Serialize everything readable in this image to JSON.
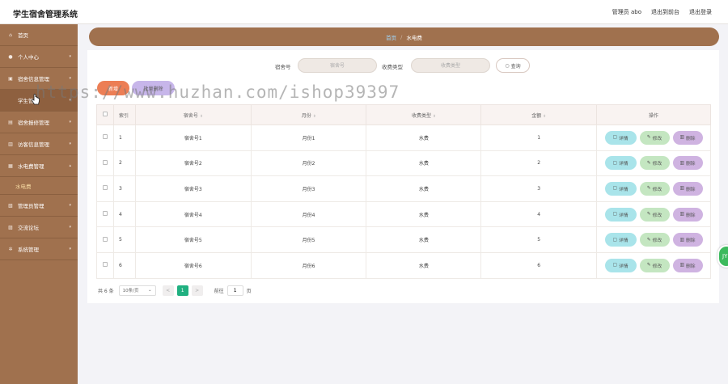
{
  "header": {
    "app_title": "学生宿舍管理系统",
    "user": "管理员 abo",
    "go_frontend": "退出到前台",
    "logout": "退出登录"
  },
  "sidebar": {
    "items": [
      {
        "label": "首页",
        "icon": "home-icon",
        "has_arrow": false
      },
      {
        "label": "个人中心",
        "icon": "user-icon",
        "has_arrow": true
      },
      {
        "label": "宿舍信息管理",
        "icon": "building-icon",
        "has_arrow": true
      },
      {
        "label": "学生管理",
        "icon": "student-icon",
        "has_arrow": true
      },
      {
        "label": "宿舍报修管理",
        "icon": "wrench-icon",
        "has_arrow": true
      },
      {
        "label": "访客信息管理",
        "icon": "visitor-icon",
        "has_arrow": true
      },
      {
        "label": "水电费管理",
        "icon": "bolt-icon",
        "has_arrow": true
      },
      {
        "label": "管理员管理",
        "icon": "admin-icon",
        "has_arrow": true
      },
      {
        "label": "交流论坛",
        "icon": "chat-icon",
        "has_arrow": true
      },
      {
        "label": "系统管理",
        "icon": "gear-icon",
        "has_arrow": true
      }
    ],
    "sub_item": "水电费"
  },
  "breadcrumb": {
    "home": "首页",
    "separator": "/",
    "current": "水电费"
  },
  "search": {
    "dorm_label": "宿舍号",
    "dorm_placeholder": "宿舍号",
    "type_label": "收费类型",
    "type_placeholder": "收费类型",
    "query_button": "查询"
  },
  "actions": {
    "add": "新增",
    "delete": "批量删除"
  },
  "watermark": "https://www.huzhan.com/ishop39397",
  "table": {
    "columns": [
      "索引",
      "宿舍号",
      "月份",
      "收费类型",
      "金额",
      "操作"
    ],
    "rows": [
      {
        "index": "1",
        "dorm": "宿舍号1",
        "month": "月份1",
        "type": "水费",
        "amount": "1"
      },
      {
        "index": "2",
        "dorm": "宿舍号2",
        "month": "月份2",
        "type": "水费",
        "amount": "2"
      },
      {
        "index": "3",
        "dorm": "宿舍号3",
        "month": "月份3",
        "type": "水费",
        "amount": "3"
      },
      {
        "index": "4",
        "dorm": "宿舍号4",
        "month": "月份4",
        "type": "水费",
        "amount": "4"
      },
      {
        "index": "5",
        "dorm": "宿舍号5",
        "month": "月份5",
        "type": "水费",
        "amount": "5"
      },
      {
        "index": "6",
        "dorm": "宿舍号6",
        "month": "月份6",
        "type": "水费",
        "amount": "6"
      }
    ],
    "op_detail": "详情",
    "op_edit": "修改",
    "op_delete": "删除"
  },
  "pager": {
    "total": "共 6 条",
    "page_size": "10条/页",
    "prev": "<",
    "current_page": "1",
    "next": ">",
    "goto": "前往",
    "goto_value": "1",
    "page_unit": "页"
  },
  "float_button": "JY",
  "colors": {
    "sidebar": "#a0714e",
    "accent_add": "#ec7e55",
    "accent_delete": "#c7b6ea",
    "pager_active": "#20b080"
  }
}
